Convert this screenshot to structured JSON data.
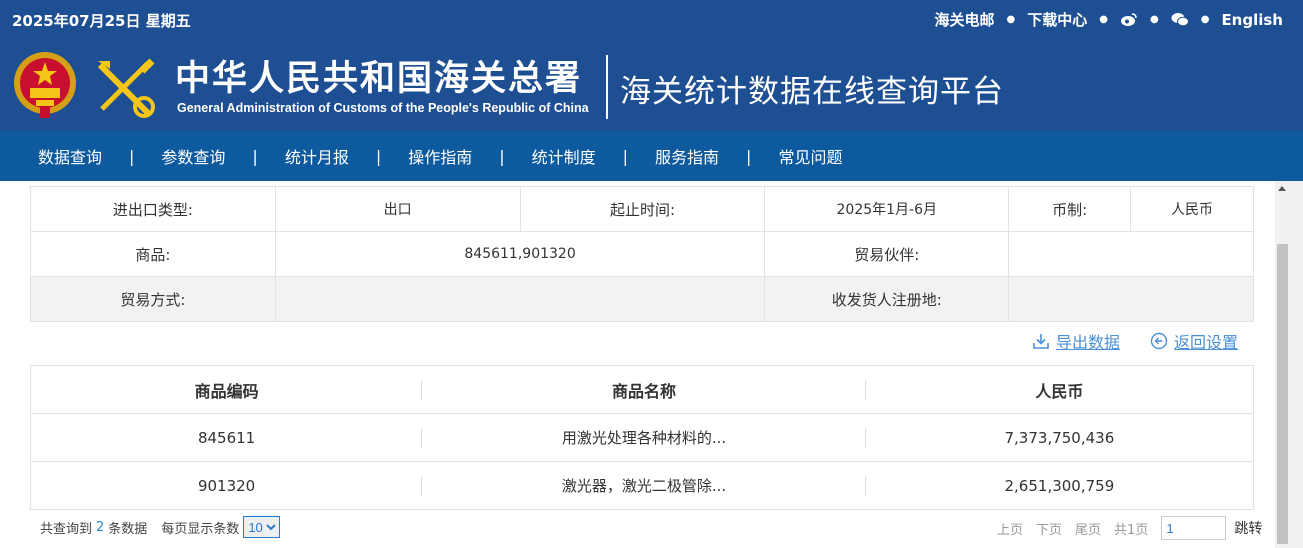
{
  "header": {
    "date": "2025年07月25日 星期五",
    "links": [
      "海关电邮",
      "下载中心",
      "English"
    ],
    "cn_title": "中华人民共和国海关总署",
    "en_title": "General Administration of Customs of the People's Republic of China",
    "platform_title": "海关统计数据在线查询平台"
  },
  "nav": [
    "数据查询",
    "参数查询",
    "统计月报",
    "操作指南",
    "统计制度",
    "服务指南",
    "常见问题"
  ],
  "conditions": {
    "trade_type_label": "进出口类型:",
    "trade_type_value": "出口",
    "period_label": "起止时间:",
    "period_value": "2025年1月-6月",
    "currency_label": "币制:",
    "currency_value": "人民币",
    "goods_label": "商品:",
    "goods_value": "845611,901320",
    "partner_label": "贸易伙伴:",
    "partner_value": "",
    "mode_label": "贸易方式:",
    "mode_value": "",
    "registry_label": "收发货人注册地:",
    "registry_value": ""
  },
  "actions": {
    "export": "导出数据",
    "back": "返回设置"
  },
  "results": {
    "columns": [
      "商品编码",
      "商品名称",
      "人民币"
    ],
    "rows": [
      [
        "845611",
        "用激光处理各种材料的...",
        "7,373,750,436"
      ],
      [
        "901320",
        "激光器，激光二极管除...",
        "2,651,300,759"
      ]
    ]
  },
  "pagination": {
    "total_prefix": "共查询到",
    "total_count": "2",
    "total_suffix": "条数据",
    "per_page_label": "每页显示条数",
    "per_page_value": "10",
    "prev": "上页",
    "next": "下页",
    "last": "尾页",
    "pages": "共1页",
    "page_input": "1",
    "go": "跳转"
  },
  "colors": {
    "header_bg": "#1f4f93",
    "nav_bg": "#0e5a9f",
    "link": "#4a90d9"
  }
}
